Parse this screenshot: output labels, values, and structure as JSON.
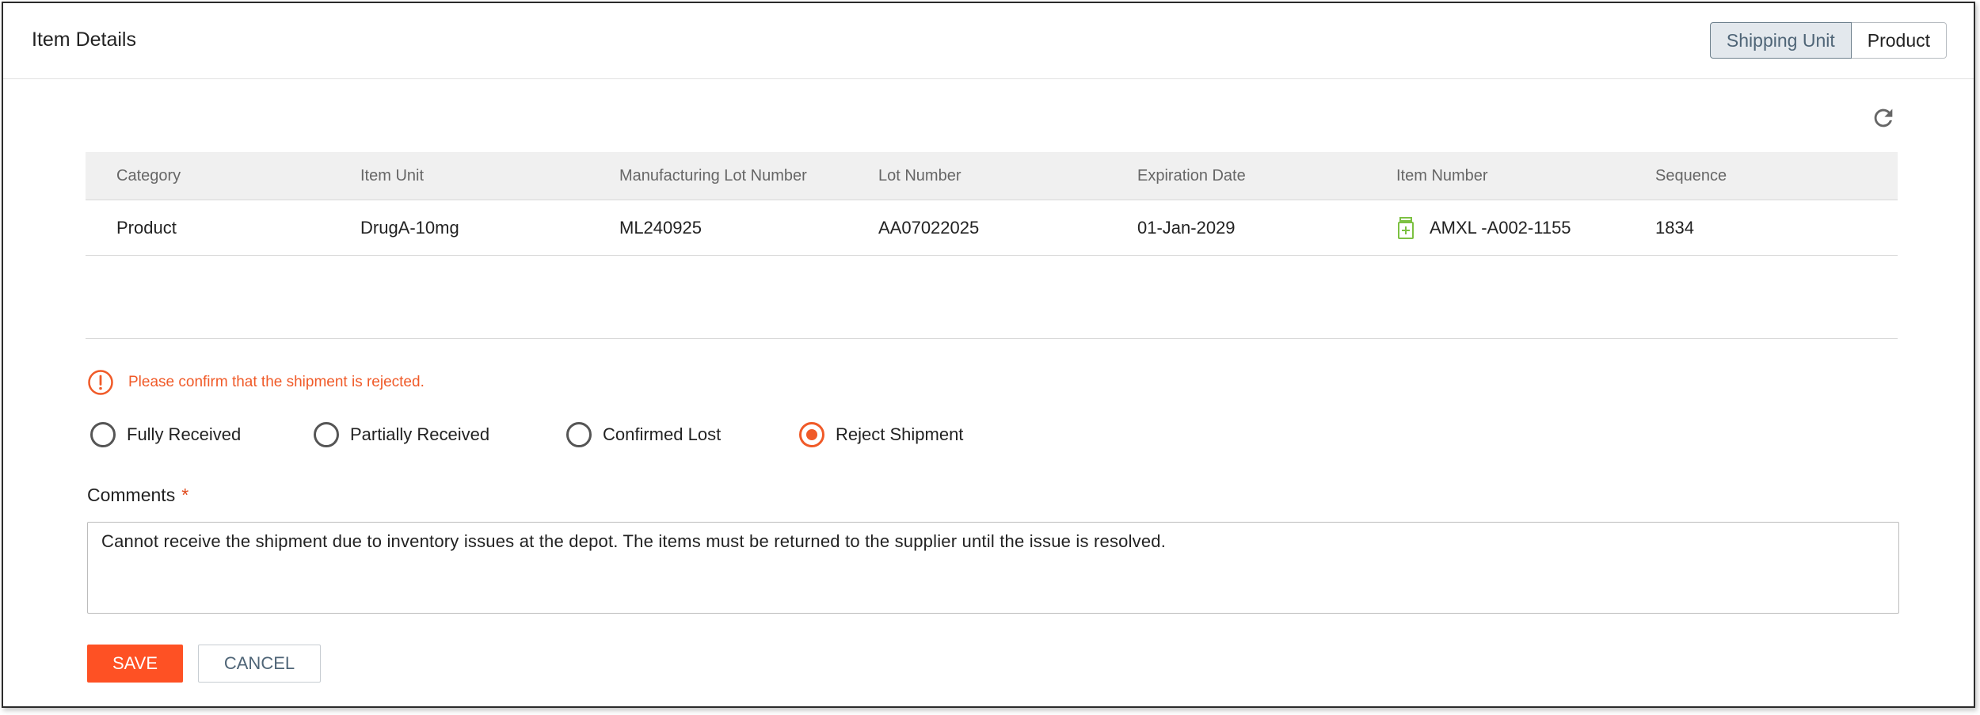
{
  "header": {
    "title": "Item Details",
    "toggle": {
      "shipping_unit": "Shipping Unit",
      "product": "Product",
      "active": "Shipping Unit"
    }
  },
  "icons": {
    "refresh": "refresh-icon",
    "item_number": "medicine-bottle-icon",
    "alert": "exclamation-circle-icon"
  },
  "colors": {
    "accent": "#fe5124",
    "alert": "#f05a28",
    "item_icon": "#7cc142",
    "toggle_active_bg": "#e3e8ed"
  },
  "table": {
    "columns": [
      "Category",
      "Item Unit",
      "Manufacturing Lot Number",
      "Lot Number",
      "Expiration Date",
      "Item Number",
      "Sequence"
    ],
    "rows": [
      [
        "Product",
        "DrugA-10mg",
        "ML240925",
        "AA07022025",
        "01-Jan-2029",
        "AMXL -A002-1155",
        "1834"
      ]
    ]
  },
  "alert": {
    "message": "Please confirm that the shipment is rejected."
  },
  "status_options": [
    {
      "label": "Fully Received",
      "checked": false
    },
    {
      "label": "Partially Received",
      "checked": false
    },
    {
      "label": "Confirmed Lost",
      "checked": false
    },
    {
      "label": "Reject Shipment",
      "checked": true
    }
  ],
  "comments": {
    "label": "Comments",
    "required_mark": "*",
    "value": "Cannot receive the shipment due to inventory issues at the depot. The items must be returned to the supplier until the issue is resolved."
  },
  "actions": {
    "save": "SAVE",
    "cancel": "CANCEL"
  }
}
